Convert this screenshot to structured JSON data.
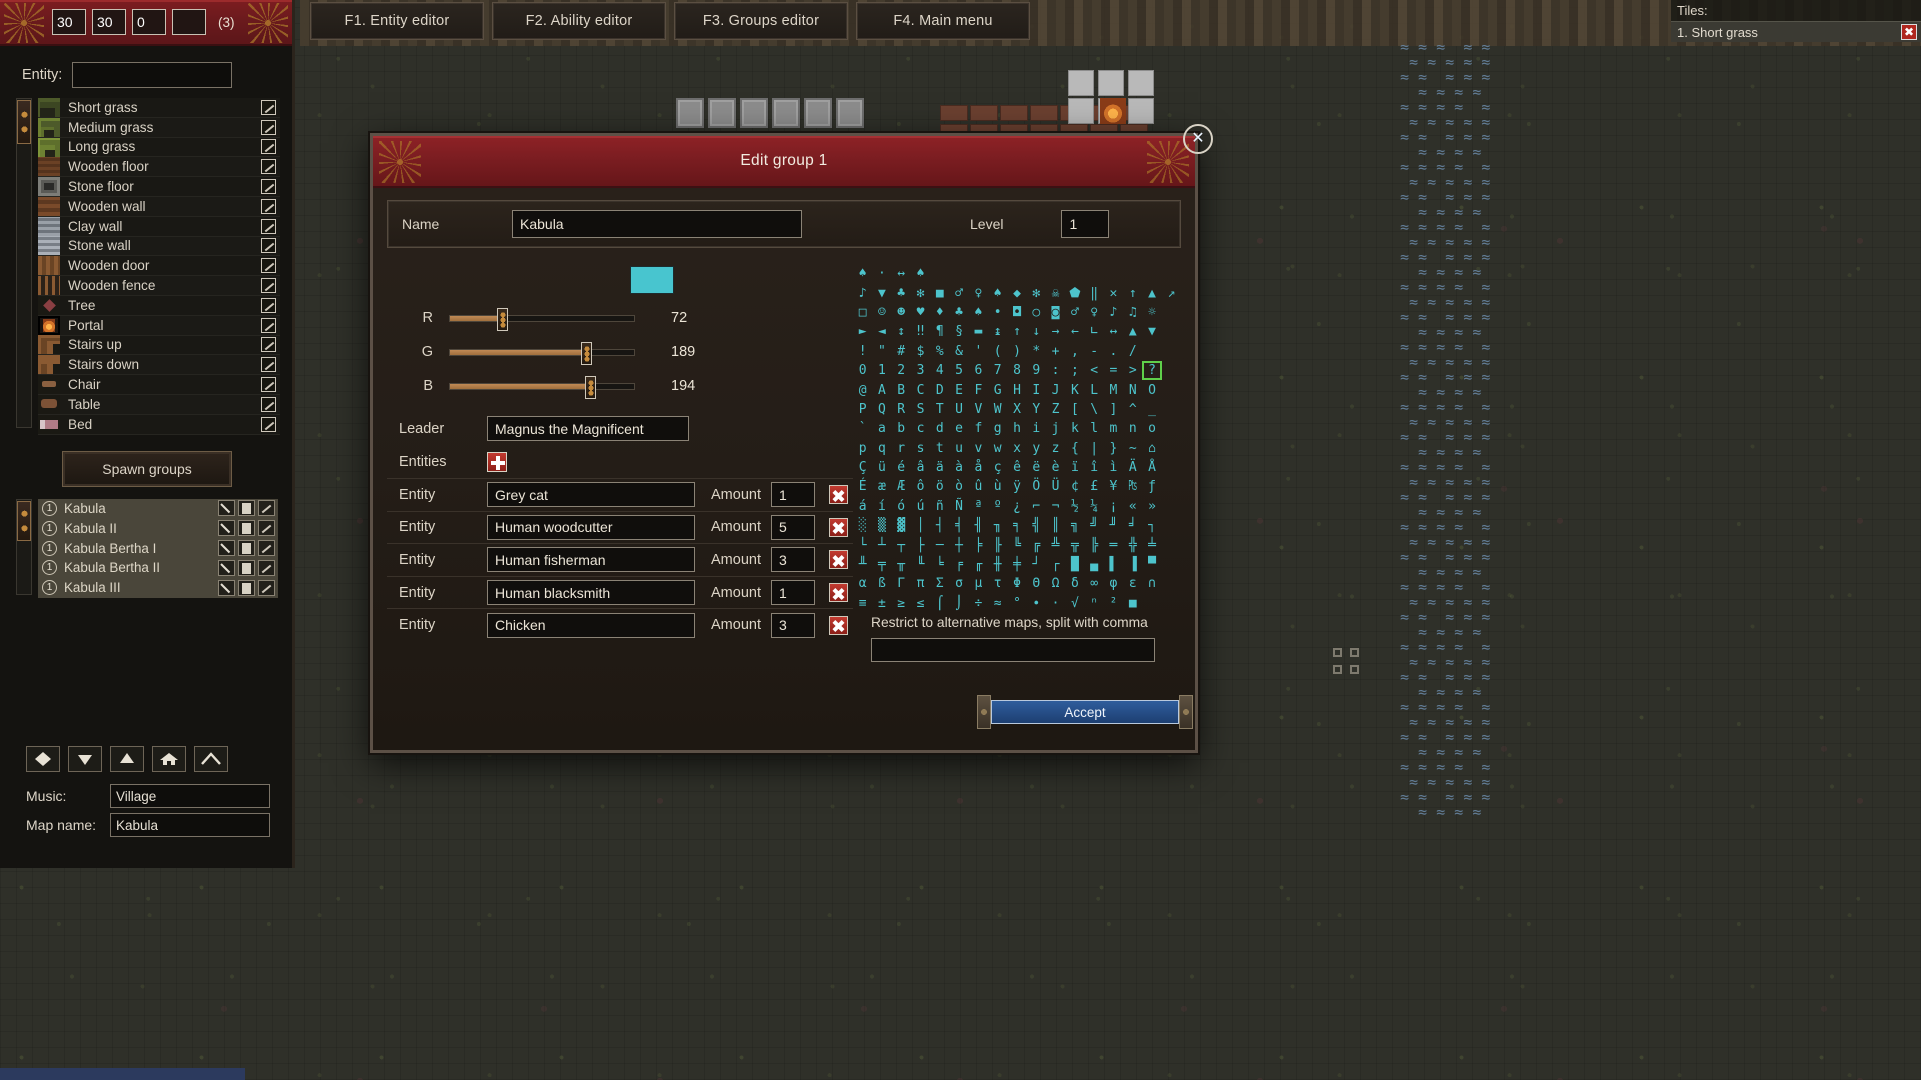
{
  "window": {
    "title": "Edit group 1"
  },
  "topTabs": [
    {
      "label": "F1. Entity editor",
      "name": "tab-entity-editor"
    },
    {
      "label": "F2. Ability editor",
      "name": "tab-ability-editor"
    },
    {
      "label": "F3. Groups editor",
      "name": "tab-groups-editor"
    },
    {
      "label": "F4. Main menu",
      "name": "tab-main-menu"
    }
  ],
  "tilesPanel": {
    "title": "Tiles:",
    "items": [
      {
        "label": "1. Short grass",
        "close": "✖"
      }
    ]
  },
  "sidebar": {
    "header": {
      "values": [
        "30",
        "30",
        "0",
        ""
      ],
      "count": "(3)"
    },
    "entityLabel": "Entity:",
    "entitySearchValue": "",
    "entities": [
      {
        "label": "Short grass",
        "icon": "ic-shortgrass"
      },
      {
        "label": "Medium grass",
        "icon": "ic-medgrass"
      },
      {
        "label": "Long grass",
        "icon": "ic-longgrass"
      },
      {
        "label": "Wooden floor",
        "icon": "ic-woodfloor"
      },
      {
        "label": "Stone floor",
        "icon": "ic-stonefloor"
      },
      {
        "label": "Wooden wall",
        "icon": "ic-woodwall"
      },
      {
        "label": "Clay wall",
        "icon": "ic-claywall"
      },
      {
        "label": "Stone wall",
        "icon": "ic-stonewall"
      },
      {
        "label": "Wooden door",
        "icon": "ic-wooddoor"
      },
      {
        "label": "Wooden fence",
        "icon": "ic-woodfence"
      },
      {
        "label": "Tree",
        "icon": "ic-tree"
      },
      {
        "label": "Portal",
        "icon": "ic-portal"
      },
      {
        "label": "Stairs up",
        "icon": "ic-stairsup"
      },
      {
        "label": "Stairs down",
        "icon": "ic-stairsdn"
      },
      {
        "label": "Chair",
        "icon": "ic-chair"
      },
      {
        "label": "Table",
        "icon": "ic-table"
      },
      {
        "label": "Bed",
        "icon": "ic-bed"
      }
    ],
    "spawnGroupsLabel": "Spawn groups",
    "groups": [
      {
        "badge": "1",
        "label": "Kabula"
      },
      {
        "badge": "1",
        "label": "Kabula II"
      },
      {
        "badge": "1",
        "label": "Kabula Bertha I"
      },
      {
        "badge": "1",
        "label": "Kabula Bertha II"
      },
      {
        "badge": "1",
        "label": "Kabula III"
      }
    ],
    "tools": [
      {
        "name": "tool-diamond-icon"
      },
      {
        "name": "tool-triangle-down-icon"
      },
      {
        "name": "tool-triangle-up-icon"
      },
      {
        "name": "tool-house-icon"
      },
      {
        "name": "tool-roof-icon"
      }
    ],
    "musicLabel": "Music:",
    "musicValue": "Village",
    "mapNameLabel": "Map name:",
    "mapNameValue": "Kabula"
  },
  "dialog": {
    "nameLabel": "Name",
    "nameValue": "Kabula",
    "levelLabel": "Level",
    "levelValue": "1",
    "swatchColor": "#48c5cf",
    "sliders": [
      {
        "letter": "R",
        "value": "72",
        "pct": 28
      },
      {
        "letter": "G",
        "value": "189",
        "pct": 74
      },
      {
        "letter": "B",
        "value": "194",
        "pct": 76
      }
    ],
    "leaderLabel": "Leader",
    "leaderValue": "Magnus the Magnificent",
    "entitiesLabel": "Entities",
    "addButtonIcon": "plus-icon",
    "entityRows": [
      {
        "label": "Entity",
        "value": "Grey cat",
        "amountLabel": "Amount",
        "amount": "1"
      },
      {
        "label": "Entity",
        "value": "Human woodcutter",
        "amountLabel": "Amount",
        "amount": "5"
      },
      {
        "label": "Entity",
        "value": "Human fisherman",
        "amountLabel": "Amount",
        "amount": "3"
      },
      {
        "label": "Entity",
        "value": "Human blacksmith",
        "amountLabel": "Amount",
        "amount": "1"
      },
      {
        "label": "Entity",
        "value": "Chicken",
        "amountLabel": "Amount",
        "amount": "3"
      }
    ],
    "restrictLabel": "Restrict to alternative maps, split with comma",
    "restrictValue": "",
    "acceptLabel": "Accept",
    "closeIcon": "✕",
    "glyphRows": [
      [
        "♠",
        "·",
        "↔",
        "♠",
        "",
        "",
        "",
        "",
        "",
        "",
        "",
        "",
        "",
        "",
        "",
        "",
        ""
      ],
      [
        "♪",
        "▼",
        "♣",
        "✻",
        "■",
        "♂",
        "♀",
        "♠",
        "◆",
        "✻",
        "☠",
        "⬟",
        "‖",
        "✕",
        "↑",
        "▲",
        "↗"
      ],
      [
        "□",
        "☺",
        "☻",
        "♥",
        "♦",
        "♣",
        "♠",
        "•",
        "◘",
        "○",
        "◙",
        "♂",
        "♀",
        "♪",
        "♫",
        "☼",
        ""
      ],
      [
        "►",
        "◄",
        "↕",
        "‼",
        "¶",
        "§",
        "▬",
        "↨",
        "↑",
        "↓",
        "→",
        "←",
        "∟",
        "↔",
        "▲",
        "▼",
        ""
      ],
      [
        "!",
        "\"",
        "#",
        "$",
        "%",
        "&",
        "'",
        "(",
        ")",
        "*",
        "+",
        ",",
        "-",
        ".",
        "/",
        "",
        ""
      ],
      [
        "0",
        "1",
        "2",
        "3",
        "4",
        "5",
        "6",
        "7",
        "8",
        "9",
        ":",
        ";",
        "<",
        "=",
        ">",
        "?",
        ""
      ],
      [
        "@",
        "A",
        "B",
        "C",
        "D",
        "E",
        "F",
        "G",
        "H",
        "I",
        "J",
        "K",
        "L",
        "M",
        "N",
        "O",
        ""
      ],
      [
        "P",
        "Q",
        "R",
        "S",
        "T",
        "U",
        "V",
        "W",
        "X",
        "Y",
        "Z",
        "[",
        "\\",
        "]",
        "^",
        "_",
        ""
      ],
      [
        "`",
        "a",
        "b",
        "c",
        "d",
        "e",
        "f",
        "g",
        "h",
        "i",
        "j",
        "k",
        "l",
        "m",
        "n",
        "o",
        ""
      ],
      [
        "p",
        "q",
        "r",
        "s",
        "t",
        "u",
        "v",
        "w",
        "x",
        "y",
        "z",
        "{",
        "|",
        "}",
        "~",
        "⌂",
        ""
      ],
      [
        "Ç",
        "ü",
        "é",
        "â",
        "ä",
        "à",
        "å",
        "ç",
        "ê",
        "ë",
        "è",
        "ï",
        "î",
        "ì",
        "Ä",
        "Å",
        ""
      ],
      [
        "É",
        "æ",
        "Æ",
        "ô",
        "ö",
        "ò",
        "û",
        "ù",
        "ÿ",
        "Ö",
        "Ü",
        "¢",
        "£",
        "¥",
        "₧",
        "ƒ",
        ""
      ],
      [
        "á",
        "í",
        "ó",
        "ú",
        "ñ",
        "Ñ",
        "ª",
        "º",
        "¿",
        "⌐",
        "¬",
        "½",
        "¼",
        "¡",
        "«",
        "»",
        ""
      ],
      [
        "░",
        "▒",
        "▓",
        "│",
        "┤",
        "╡",
        "╢",
        "╖",
        "╕",
        "╣",
        "║",
        "╗",
        "╝",
        "╜",
        "╛",
        "┐",
        ""
      ],
      [
        "└",
        "┴",
        "┬",
        "├",
        "─",
        "┼",
        "╞",
        "╟",
        "╚",
        "╔",
        "╩",
        "╦",
        "╠",
        "═",
        "╬",
        "╧",
        ""
      ],
      [
        "╨",
        "╤",
        "╥",
        "╙",
        "╘",
        "╒",
        "╓",
        "╫",
        "╪",
        "┘",
        "┌",
        "█",
        "▄",
        "▌",
        "▐",
        "▀",
        ""
      ],
      [
        "α",
        "ß",
        "Γ",
        "π",
        "Σ",
        "σ",
        "µ",
        "τ",
        "Φ",
        "Θ",
        "Ω",
        "δ",
        "∞",
        "φ",
        "ε",
        "∩",
        ""
      ],
      [
        "≡",
        "±",
        "≥",
        "≤",
        "⌠",
        "⌡",
        "÷",
        "≈",
        "°",
        "∙",
        "·",
        "√",
        "ⁿ",
        "²",
        "■",
        " ",
        ""
      ]
    ],
    "selectedGlyph": "?"
  }
}
